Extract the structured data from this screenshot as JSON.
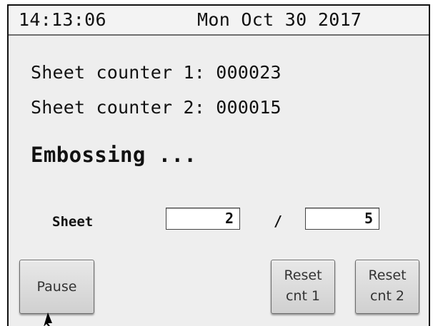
{
  "header": {
    "time": "14:13:06",
    "date": "Mon Oct 30 2017"
  },
  "counters": [
    {
      "label": "Sheet counter 1: 000023"
    },
    {
      "label": "Sheet counter 2: 000015"
    }
  ],
  "status": "Embossing ...",
  "sheet": {
    "label": "Sheet",
    "current": "2",
    "separator": "/",
    "total": "5"
  },
  "buttons": {
    "pause": "Pause",
    "reset1_line1": "Reset",
    "reset1_line2": "cnt 1",
    "reset2_line1": "Reset",
    "reset2_line2": "cnt 2"
  },
  "icons": {
    "pointer": "mouse-pointer-icon"
  }
}
